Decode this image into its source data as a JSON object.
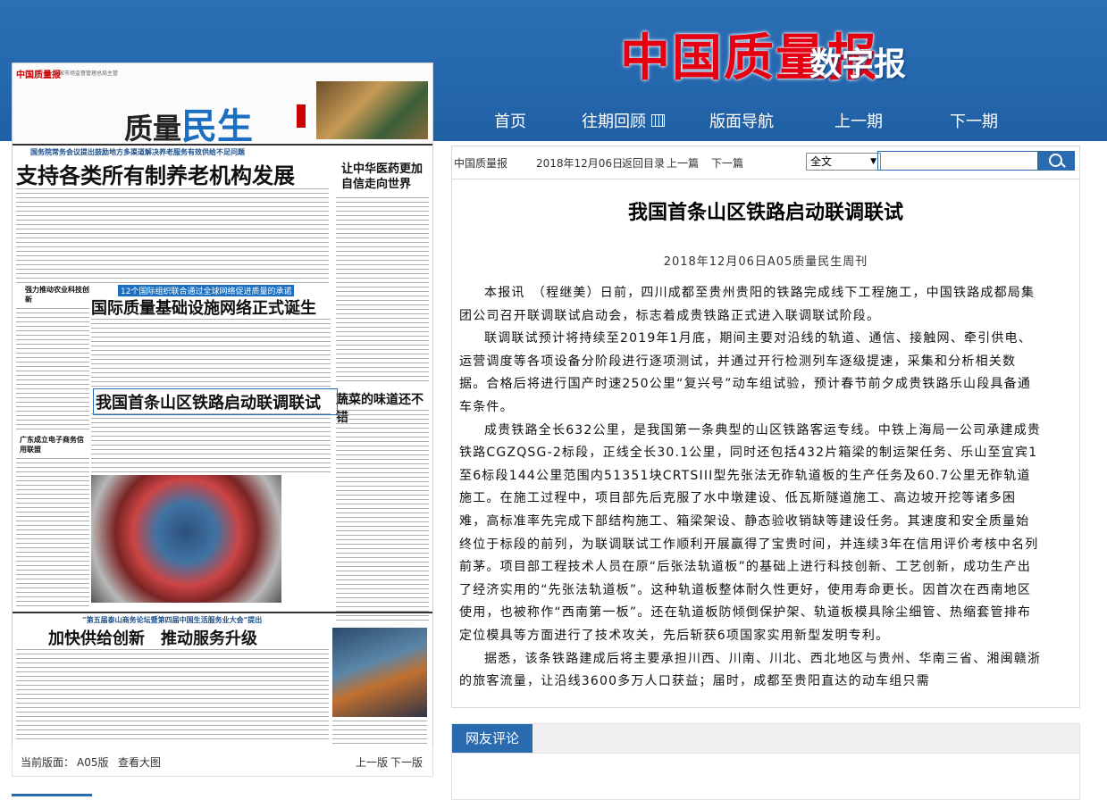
{
  "header": {
    "logo_text": "中国质量报",
    "logo_suffix": "数字报",
    "nav": [
      "首页",
      "往期回顾",
      "版面导航",
      "上一期",
      "下一期"
    ]
  },
  "paper_page": {
    "masthead": "中国质量报",
    "masthead_sub": "国家市场监督管理总局主管",
    "section_prefix": "质量",
    "section_emphasis": "民生",
    "headline_1_kicker": "国务院常务会议提出鼓励地方多渠道解决养老服务有效供给不足问题",
    "headline_1": "支持各类所有制养老机构发展",
    "headline_2_kicker": "12个国际组织联合通过全球网络促进质量的承诺",
    "headline_2": "国际质量基础设施网络正式诞生",
    "headline_3": "我国首条山区铁路启动联调联试",
    "headline_4": "让中华医药更加自信走向世界",
    "headline_5": "蔬菜的味道还不错",
    "headline_6_kicker": "“第五届泰山商务论坛暨第四届中国生活服务业大会”提出",
    "headline_6": "加快供给创新　推动服务升级",
    "side_1": "强力推动农业科技创新",
    "side_2": "广东成立电子商务信用联盟"
  },
  "page_footer": {
    "current_label": "当前版面：",
    "current_value": "A05版",
    "view_large": "查看大图",
    "prev": "上一版",
    "next": "下一版"
  },
  "article_toolbar": {
    "source": "中国质量报",
    "date": "2018年12月06日",
    "back": "返回目录",
    "prev": "上一篇",
    "next": "下一篇",
    "search_scope": "全文",
    "search_value": ""
  },
  "article": {
    "title": "我国首条山区铁路启动联调联试",
    "dateline": "2018年12月06日A05质量民生周刊",
    "paragraphs": [
      "本报讯　（程继美）日前，四川成都至贵州贵阳的铁路完成线下工程施工，中国铁路成都局集团公司召开联调联试启动会，标志着成贵铁路正式进入联调联试阶段。",
      "联调联试预计将持续至2019年1月底，期间主要对沿线的轨道、通信、接触网、牵引供电、运营调度等各项设备分阶段进行逐项测试，并通过开行检测列车逐级提速，采集和分析相关数据。合格后将进行国产时速250公里“复兴号”动车组试验，预计春节前夕成贵铁路乐山段具备通车条件。",
      "成贵铁路全长632公里，是我国第一条典型的山区铁路客运专线。中铁上海局一公司承建成贵铁路CGZQSG-2标段，正线全长30.1公里，同时还包括432片箱梁的制运架任务、乐山至宜宾1至6标段144公里范围内51351块CRTSIII型先张法无砟轨道板的生产任务及60.7公里无砟轨道施工。在施工过程中，项目部先后克服了水中墩建设、低瓦斯隧道施工、高边坡开挖等诸多困难，高标准率先完成下部结构施工、箱梁架设、静态验收销缺等建设任务。其速度和安全质量始终位于标段的前列，为联调联试工作顺利开展赢得了宝贵时间，并连续3年在信用评价考核中名列前茅。项目部工程技术人员在原“后张法轨道板”的基础上进行科技创新、工艺创新，成功生产出了经济实用的“先张法轨道板”。这种轨道板整体耐久性更好，使用寿命更长。因首次在西南地区使用，也被称作“西南第一板”。还在轨道板防倾倒保护架、轨道板模具除尘细管、热缩套管排布定位模具等方面进行了技术攻关，先后斩获6项国家实用新型发明专利。",
      "据悉，该条铁路建成后将主要承担川西、川南、川北、西北地区与贵州、华南三省、湘闽赣浙的旅客流量，让沿线3600多万人口获益；届时，成都至贵阳直达的动车组只需"
    ]
  },
  "comments": {
    "tab_label": "网友评论"
  },
  "colors": {
    "header_blue": "#2567ad",
    "logo_red": "#e60012",
    "accent_blue": "#2a6bb0"
  }
}
